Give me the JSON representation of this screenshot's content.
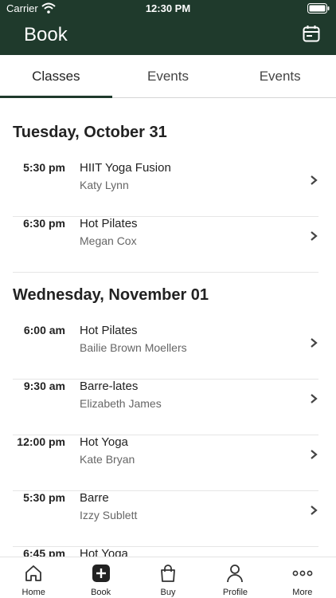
{
  "status_bar": {
    "carrier": "Carrier",
    "time": "12:30 PM"
  },
  "header": {
    "title": "Book",
    "calendar_icon": "calendar-icon"
  },
  "tabs": [
    {
      "label": "Classes",
      "active": true
    },
    {
      "label": "Events",
      "active": false
    },
    {
      "label": "Events",
      "active": false
    }
  ],
  "days": [
    {
      "heading": "Tuesday, October 31",
      "classes": [
        {
          "time": "5:30 pm",
          "name": "HIIT Yoga Fusion",
          "instructor": "Katy Lynn"
        },
        {
          "time": "6:30 pm",
          "name": "Hot Pilates",
          "instructor": "Megan Cox"
        }
      ]
    },
    {
      "heading": "Wednesday, November 01",
      "classes": [
        {
          "time": "6:00 am",
          "name": "Hot Pilates",
          "instructor": "Bailie Brown Moellers"
        },
        {
          "time": "9:30 am",
          "name": "Barre-lates",
          "instructor": "Elizabeth James"
        },
        {
          "time": "12:00 pm",
          "name": "Hot Yoga",
          "instructor": "Kate Bryan"
        },
        {
          "time": "5:30 pm",
          "name": "Barre",
          "instructor": "Izzy Sublett"
        },
        {
          "time": "6:45 pm",
          "name": "Hot Yoga",
          "instructor": ""
        }
      ]
    }
  ],
  "bottom_nav": [
    {
      "label": "Home",
      "icon": "home-icon"
    },
    {
      "label": "Book",
      "icon": "plus-square-icon",
      "active": true
    },
    {
      "label": "Buy",
      "icon": "bag-icon"
    },
    {
      "label": "Profile",
      "icon": "person-icon"
    },
    {
      "label": "More",
      "icon": "more-dots-icon"
    }
  ],
  "colors": {
    "header_bg": "#1f3a2c",
    "accent": "#1f3a2c"
  }
}
